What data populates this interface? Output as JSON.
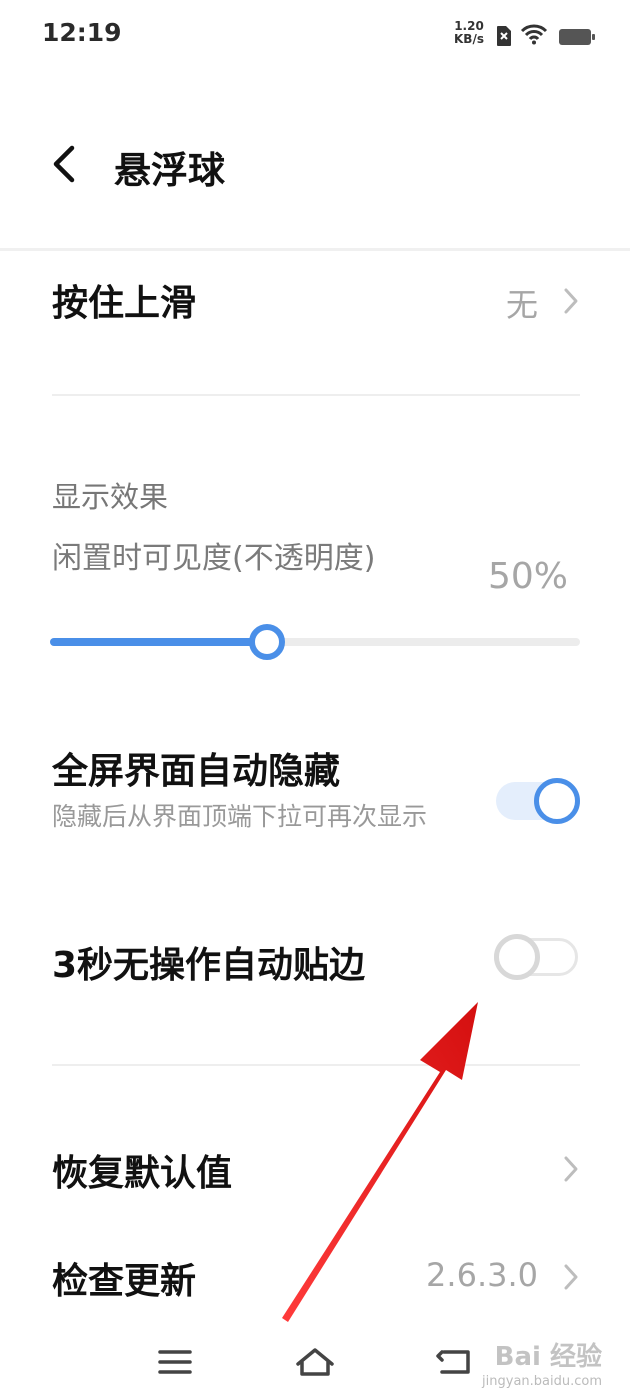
{
  "status_bar": {
    "time": "12:19",
    "net_speed_value": "1.20",
    "net_speed_unit": "KB/s",
    "icons": [
      "sim-off-icon",
      "wifi-icon",
      "battery-icon"
    ]
  },
  "header": {
    "title": "悬浮球",
    "back_icon": "chevron-left-icon"
  },
  "settings": {
    "swipe_up": {
      "label": "按住上滑",
      "value": "无"
    },
    "display_section": {
      "title": "显示效果"
    },
    "idle_opacity": {
      "label": "闲置时可见度(不透明度)",
      "value": "50%",
      "percent": 50
    },
    "auto_hide_fullscreen": {
      "label": "全屏界面自动隐藏",
      "description": "隐藏后从界面顶端下拉可再次显示",
      "enabled": true
    },
    "auto_dock": {
      "label": "3秒无操作自动贴边",
      "enabled": false
    },
    "restore_defaults": {
      "label": "恢复默认值"
    },
    "check_update": {
      "label": "检查更新",
      "value": "2.6.3.0"
    }
  },
  "nav_bar": {
    "items": [
      "menu-icon",
      "home-icon",
      "back-icon"
    ]
  },
  "watermark": {
    "text": "Bai 经验",
    "sub": "jingyan.baidu.com"
  },
  "colors": {
    "accent": "#4a8fe8",
    "annotation": "#e31b1b",
    "muted_text": "#a6a6a6"
  }
}
